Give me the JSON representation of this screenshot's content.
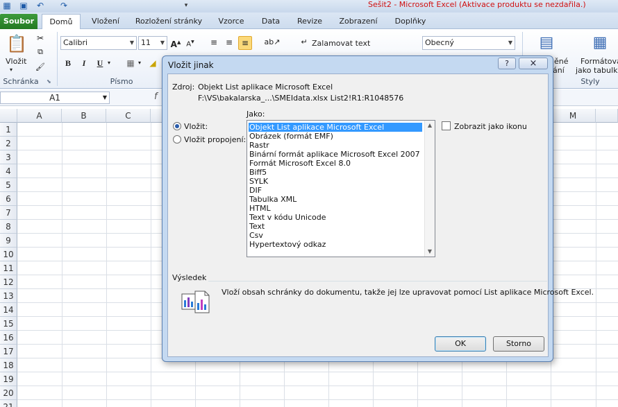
{
  "window": {
    "title": "Sešit2  -  Microsoft Excel (Aktivace produktu se nezdařila.)"
  },
  "ribbon_tabs": [
    "Soubor",
    "Domů",
    "Vložení",
    "Rozložení stránky",
    "Vzorce",
    "Data",
    "Revize",
    "Zobrazení",
    "Doplňky"
  ],
  "ribbon": {
    "paste_label": "Vložit",
    "clipboard_group": "Schránka",
    "font_group": "Písmo",
    "styles_group": "Styly",
    "font_name": "Calibri",
    "font_size": "11",
    "wrap_text": "Zalamovat text",
    "number_format": "Obecný",
    "cond_format_1": "ěné",
    "cond_format_2": "ání",
    "format_table_1": "Formátovat",
    "format_table_2": "jako tabulku",
    "bold": "B",
    "italic": "I",
    "underline": "U"
  },
  "formula_bar": {
    "name_box": "A1",
    "fx": "f"
  },
  "grid": {
    "columns": [
      "A",
      "B",
      "C",
      "M"
    ],
    "rows": [
      "1",
      "2",
      "3",
      "4",
      "5",
      "6",
      "7",
      "8",
      "9",
      "10",
      "11",
      "12",
      "13",
      "14",
      "15",
      "16",
      "17",
      "18",
      "19",
      "20",
      "21"
    ]
  },
  "dialog": {
    "title": "Vložit jinak",
    "help_button": "?",
    "close_button": "×",
    "source_label": "Zdroj:",
    "source_line1": "Objekt List aplikace Microsoft Excel",
    "source_line2": "F:\\VS\\bakalarska_...\\SMEIdata.xlsx List2!R1:R1048576",
    "as_label": "Jako:",
    "radio_paste": "Vložit:",
    "radio_paste_link": "Vložit propojení:",
    "display_as_icon": "Zobrazit jako ikonu",
    "formats": [
      "Objekt List aplikace Microsoft Excel",
      "Obrázek (formát EMF)",
      "Rastr",
      "Binární formát aplikace Microsoft Excel 2007",
      "Formát Microsoft Excel 8.0",
      "Biff5",
      "SYLK",
      "DIF",
      "Tabulka XML",
      "HTML",
      "Text v kódu Unicode",
      "Text",
      "Csv",
      "Hypertextový odkaz"
    ],
    "selected_format_index": 0,
    "result_label": "Výsledek",
    "result_text": "Vloží obsah schránky do dokumentu, takže jej lze upravovat pomocí List aplikace Microsoft Excel.",
    "ok": "OK",
    "cancel": "Storno"
  },
  "colors": {
    "file_tab": "#2f8a2e",
    "selection": "#3399ff",
    "title_text": "#d01010"
  }
}
